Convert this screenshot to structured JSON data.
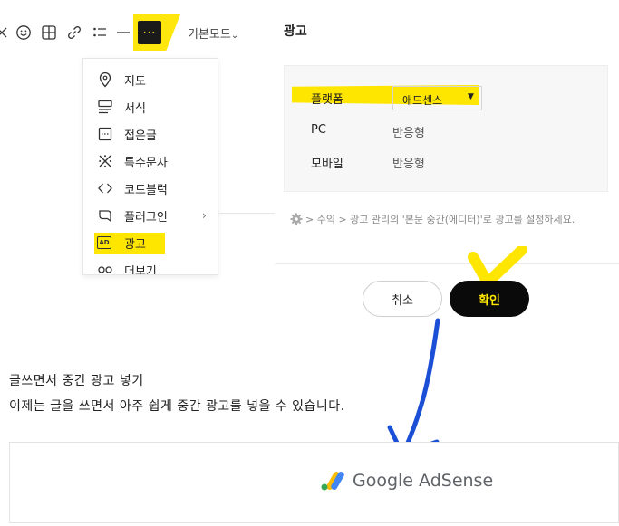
{
  "toolbar": {
    "icons": [
      "emoji-icon",
      "table-icon",
      "link-icon",
      "list-icon",
      "horizontal-rule-icon",
      "more-icon"
    ],
    "more_label": "···",
    "mode_label": "기본모드",
    "mode_arrow": "⌄"
  },
  "menu": {
    "items": [
      {
        "label": "지도",
        "icon": "map-pin-icon"
      },
      {
        "label": "서식",
        "icon": "format-icon"
      },
      {
        "label": "접은글",
        "icon": "folded-text-icon"
      },
      {
        "label": "특수문자",
        "icon": "special-char-icon"
      },
      {
        "label": "코드블럭",
        "icon": "code-block-icon"
      },
      {
        "label": "플러그인",
        "icon": "plugin-icon",
        "arrow": "›"
      },
      {
        "label": "광고",
        "icon": "ad-icon",
        "icon_text": "AD",
        "highlighted": true
      },
      {
        "label": "더보기",
        "icon": "more-link-icon"
      }
    ]
  },
  "dialog": {
    "title": "광고",
    "platform_label": "플랫폼",
    "platform_value": "애드센스",
    "rows": [
      {
        "label": "PC",
        "value": "반응형"
      },
      {
        "label": "모바일",
        "value": "반응형"
      }
    ],
    "note": "> 수익 > 광고 관리의 '본문 중간(에디터)'로 광고를 설정하세요.",
    "cancel_label": "취소",
    "ok_label": "확인"
  },
  "content": {
    "line1": "글쓰면서 중간 광고 넣기",
    "line2": "이제는 글을 쓰면서 아주 쉽게 중간 광고를 넣을 수 있습니다.",
    "ad_brand": "Google AdSense"
  },
  "colors": {
    "highlight": "#ffe600",
    "ok_button_bg": "#0a0a0a",
    "arrow": "#1a4fd6"
  }
}
